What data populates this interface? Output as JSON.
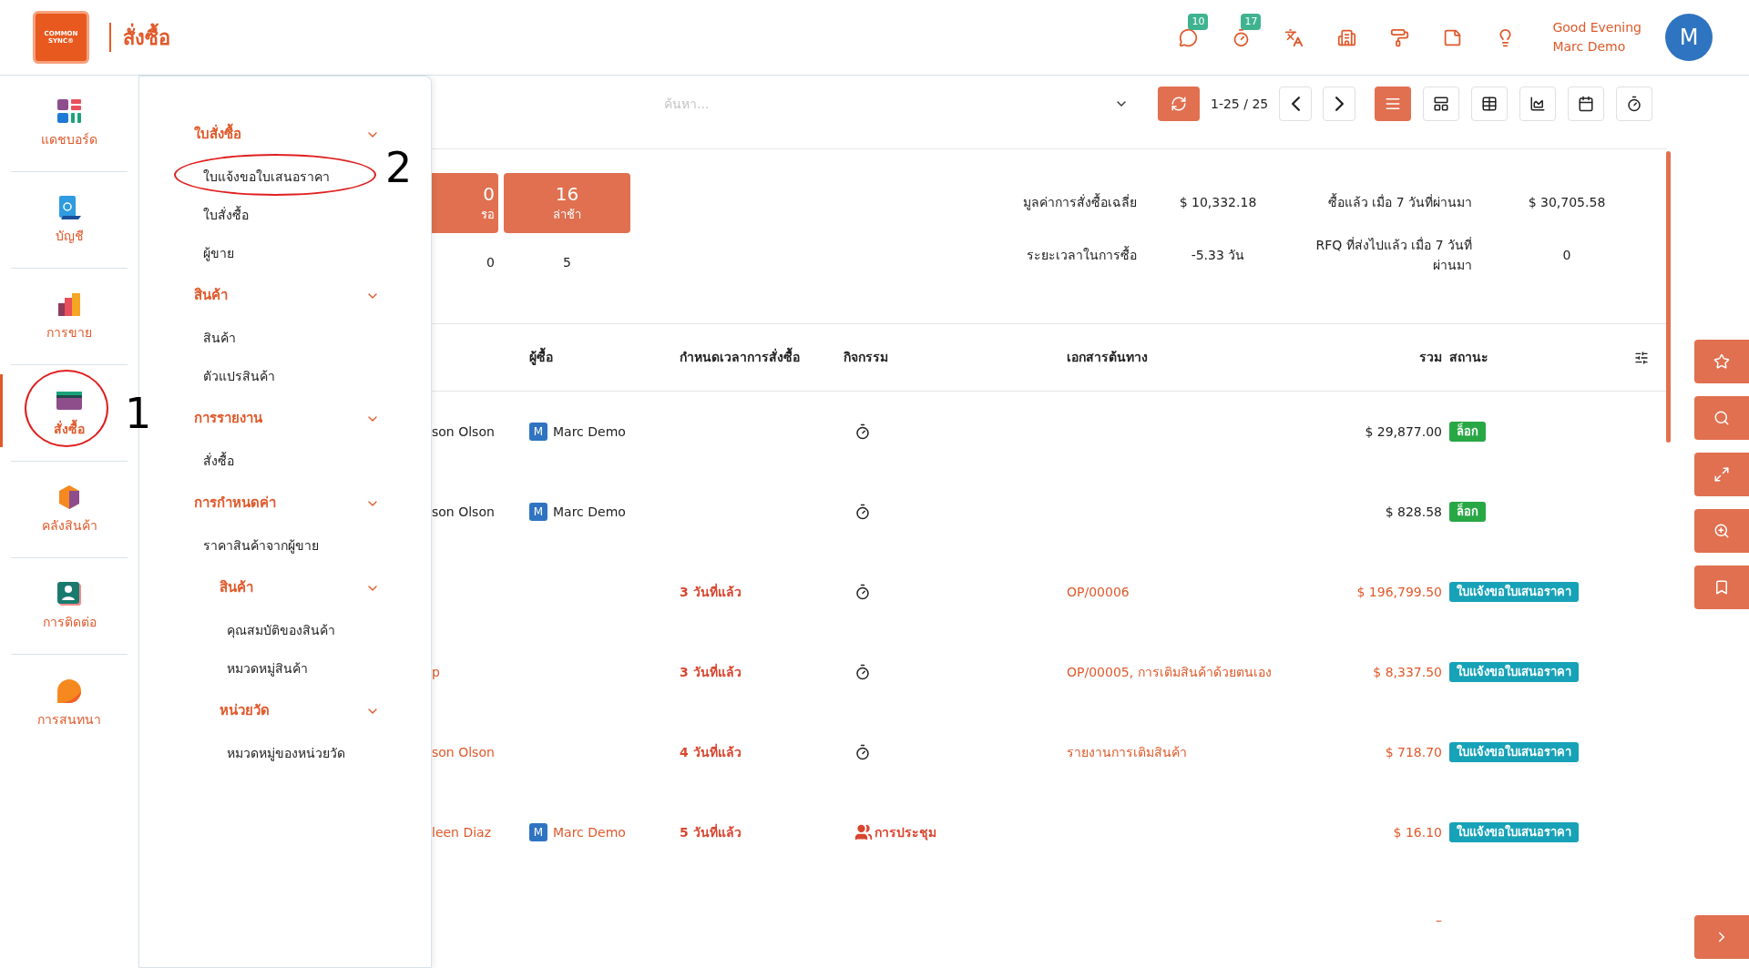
{
  "header": {
    "logo_text": [
      "COMMON",
      "SYNC®"
    ],
    "title": "สั่งซื้อ",
    "badges": [
      "10",
      "17"
    ],
    "greeting": "Good Evening",
    "user": "Marc Demo",
    "avatar": "M"
  },
  "apps": [
    {
      "label": "แดชบอร์ด",
      "selected": false
    },
    {
      "label": "บัญชี",
      "selected": false
    },
    {
      "label": "การขาย",
      "selected": false
    },
    {
      "label": "สั่งซื้อ",
      "selected": true,
      "annotation": "1"
    },
    {
      "label": "คลังสินค้า",
      "selected": false
    },
    {
      "label": "การติดต่อ",
      "selected": false
    },
    {
      "label": "การสนทนา",
      "selected": false
    }
  ],
  "menu": [
    {
      "label": "ใบสั่งซื้อ",
      "children": [
        {
          "label": "ใบแจ้งขอใบเสนอราคา",
          "annotation": "2"
        },
        {
          "label": "ใบสั่งซื้อ"
        },
        {
          "label": "ผู้ขาย"
        }
      ]
    },
    {
      "label": "สินค้า",
      "children": [
        {
          "label": "สินค้า"
        },
        {
          "label": "ตัวแปรสินค้า"
        }
      ]
    },
    {
      "label": "การรายงาน",
      "children": [
        {
          "label": "สั่งซื้อ"
        }
      ]
    },
    {
      "label": "การกำหนดค่า",
      "children": [
        {
          "label": "ราคาสินค้าจากผู้ขาย"
        },
        {
          "label": "สินค้า",
          "children": [
            {
              "label": "คุณสมบัติของสินค้า"
            },
            {
              "label": "หมวดหมู่สินค้า"
            }
          ]
        },
        {
          "label": "หน่วยวัด",
          "children": [
            {
              "label": "หมวดหมู่ของหน่วยวัด"
            }
          ]
        }
      ]
    }
  ],
  "toolbar": {
    "search_placeholder": "ค้นหา...",
    "pager": "1-25 / 25",
    "views": [
      {
        "selected": true
      },
      {
        "selected": false
      },
      {
        "selected": false
      },
      {
        "selected": false
      },
      {
        "selected": false
      },
      {
        "selected": false
      }
    ]
  },
  "stats": {
    "cards": [
      {
        "value": "0",
        "label": "รอ",
        "count": "0"
      },
      {
        "value": "16",
        "label": "ล่าช้า",
        "count": "5"
      }
    ],
    "metrics": [
      {
        "label": "มูลค่าการสั่งซื้อเฉลี่ย",
        "value": "$ 10,332.18"
      },
      {
        "label": "ซื้อแล้ว เมื่อ 7 วันที่ผ่านมา",
        "value": "$ 30,705.58"
      },
      {
        "label": "ระยะเวลาในการซื้อ",
        "value": "-5.33 วัน"
      },
      {
        "label": "RFQ ที่ส่งไปแล้ว เมื่อ 7 วันที่ผ่านมา",
        "value": "0"
      }
    ]
  },
  "table": {
    "columns": [
      "ผู้ซื้อ",
      "กำหนดเวลาการสั่งซื้อ",
      "กิจกรรม",
      "เอกสารต้นทาง",
      "รวม",
      "สถานะ"
    ],
    "rows": [
      {
        "vendor": "son Olson",
        "buyer": {
          "initial": "M",
          "name": "Marc Demo"
        },
        "activity": {
          "kind": "timer"
        },
        "total": "$ 29,877.00",
        "status": {
          "label": "ล็อก",
          "color": "#28a745"
        },
        "overdue": false
      },
      {
        "vendor": "son Olson",
        "buyer": {
          "initial": "M",
          "name": "Marc Demo"
        },
        "activity": {
          "kind": "timer"
        },
        "total": "$ 828.58",
        "status": {
          "label": "ล็อก",
          "color": "#28a745"
        },
        "overdue": false
      },
      {
        "deadline": "3 วันที่แล้ว",
        "activity": {
          "kind": "timer"
        },
        "source": "OP/00006",
        "total": "$ 196,799.50",
        "status": {
          "label": "ใบแจ้งขอใบเสนอราคา",
          "color": "#17a2b8"
        },
        "overdue": true
      },
      {
        "vendor": "p",
        "deadline": "3 วันที่แล้ว",
        "activity": {
          "kind": "timer"
        },
        "source": "OP/00005, การเติมสินค้าด้วยตนเอง",
        "total": "$ 8,337.50",
        "status": {
          "label": "ใบแจ้งขอใบเสนอราคา",
          "color": "#17a2b8"
        },
        "overdue": true
      },
      {
        "vendor": "son Olson",
        "deadline": "4 วันที่แล้ว",
        "activity": {
          "kind": "timer"
        },
        "source": "รายงานการเติมสินค้า",
        "total": "$ 718.70",
        "status": {
          "label": "ใบแจ้งขอใบเสนอราคา",
          "color": "#17a2b8"
        },
        "overdue": true
      },
      {
        "vendor": "leen Diaz",
        "buyer": {
          "initial": "M",
          "name": "Marc Demo"
        },
        "deadline": "5 วันที่แล้ว",
        "activity": {
          "kind": "meeting",
          "label": "การประชุม"
        },
        "total": "$ 16.10",
        "status": {
          "label": "ใบแจ้งขอใบเสนอราคา",
          "color": "#17a2b8"
        },
        "overdue": true
      }
    ],
    "footer_total": "–"
  }
}
